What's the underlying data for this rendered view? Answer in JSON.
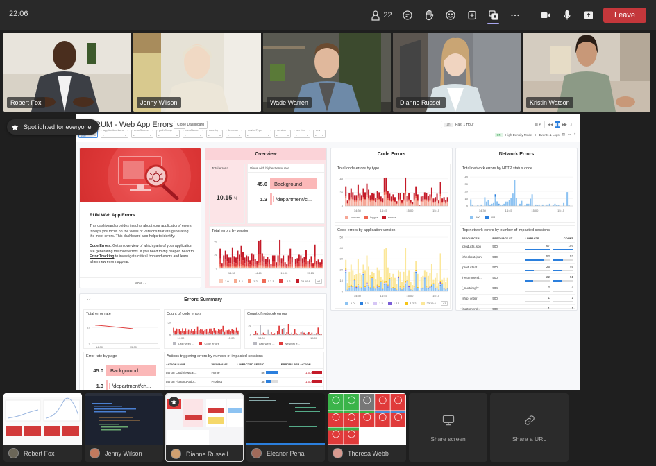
{
  "topbar": {
    "time": "22:06",
    "participants_count": "22",
    "icons": [
      "people-icon",
      "chat-icon",
      "raise-hand-icon",
      "reactions-icon",
      "apps-icon",
      "share-icon",
      "more-icon",
      "camera-icon",
      "mic-icon",
      "share-tray-icon"
    ],
    "leave_label": "Leave",
    "leave_color": "#c4373b"
  },
  "video_tiles": [
    {
      "name": "Robert Fox",
      "bg": "#c9c3b8"
    },
    {
      "name": "Jenny Wilson",
      "bg": "#d8d1bf"
    },
    {
      "name": "Wade Warren",
      "bg": "#6e6a5e"
    },
    {
      "name": "Dianne Russell",
      "bg": "#8c8f94"
    },
    {
      "name": "Kristin Watson",
      "bg": "#c8bfb2"
    }
  ],
  "spotlight": {
    "label": "Spotlighted for everyone"
  },
  "dashboard": {
    "title": "RUM - Web App Errors",
    "clone_label": "Clone Dashboard",
    "filters": [
      {
        "label": "type",
        "value": "user"
      },
      {
        "label": "applicationName",
        "value": "*"
      },
      {
        "label": "errorSource",
        "value": "*"
      },
      {
        "label": "pathGroup",
        "value": "*"
      },
      {
        "label": "viewName",
        "value": "*"
      },
      {
        "label": "country",
        "value": "*"
      },
      {
        "label": "browser",
        "value": "*"
      },
      {
        "label": "deviceType",
        "value": "*"
      },
      {
        "label": "version",
        "value": "*"
      },
      {
        "label": "service",
        "value": "*"
      },
      {
        "label": "env",
        "value": "*"
      }
    ],
    "time": {
      "short": "1h",
      "label": "Past 1 Hour"
    },
    "high_density": {
      "on": "ON",
      "label": "High Density Mode"
    },
    "events_logs": "Events & Logs",
    "about": {
      "title": "RUM Web App Errors",
      "p1": "This dashboard provides insights about your applications' errors. It helps you focus on the views or versions that are generating the most errors. This dashboard also helps to identify:",
      "p2_bold": "Code Errors:",
      "p2_a": " Get an overview of which parts of your application are generating the most errors. If you need to dig deeper, head to ",
      "p2_link": "Error Tracking",
      "p2_b": " to investigate critical frontend errors and learn when new errors appear.",
      "more": "More"
    },
    "overview": {
      "title": "Overview",
      "total_error_rate_label": "Total error r...",
      "total_error_rate_value": "10.15",
      "total_error_rate_unit": "%",
      "views_label": "Views with highest error rate",
      "views": [
        {
          "value": "45.0",
          "name": "Background",
          "fraction": 1.0
        },
        {
          "value": "1.3",
          "name": "/department/c...",
          "fraction": 0.03
        }
      ],
      "by_version_title": "Total errors by version"
    },
    "code_errors": {
      "title": "Code Errors",
      "by_type_title": "Total code errors by type",
      "by_app_version_title": "Code errors by application version"
    },
    "network_errors": {
      "title": "Network Errors",
      "by_status_title": "Total network errors by HTTP status code",
      "table_title": "Top network errors by number of impacted sessions",
      "columns": [
        "RESOURCE U...",
        "RESOURCE ST...",
        "↓ IMPACTE...",
        "COUNT"
      ],
      "rows": [
        {
          "url": "/products.json",
          "status": "500",
          "impacted": 67,
          "count": 107
        },
        {
          "url": "/checkout.json",
          "status": "500",
          "impacted": 52,
          "count": 52
        },
        {
          "url": "/products/?",
          "status": "500",
          "impacted": 25,
          "count": 46
        },
        {
          "url": "/recommend...",
          "status": "500",
          "impacted": 22,
          "count": 51
        },
        {
          "url": "/_nuxt/img/?",
          "status": "504",
          "impacted": 2,
          "count": 4
        },
        {
          "url": "/ship_order",
          "status": "500",
          "impacted": 1,
          "count": 1
        },
        {
          "url": "/customers/...",
          "status": "500",
          "impacted": 1,
          "count": 1
        }
      ]
    },
    "errors_summary": {
      "title": "Errors Summary",
      "total_error_rate_title": "Total error rate",
      "code_count_title": "Count of code errors",
      "network_count_title": "Count of network errors",
      "rate_by_page_title": "Error rate by page",
      "rate_by_page": [
        {
          "value": "45.0",
          "name": "Background",
          "fraction": 1.0
        },
        {
          "value": "1.3",
          "name": "/department/ch...",
          "fraction": 0.03
        }
      ],
      "actions_title": "Actions triggering errors by number of impacted sessions",
      "actions_columns": [
        "ACTION NAME",
        "VIEW NAME",
        "↓ IMPACTED SESSIO...",
        "ERRORS PER ACTION"
      ],
      "actions_rows": [
        {
          "action": "tap on CardView(cat...",
          "view": "Home",
          "impacted": 86,
          "errors": "1.00"
        },
        {
          "action": "tap on FloatingActio...",
          "view": "Product",
          "impacted": 38,
          "errors": "1.00"
        }
      ]
    }
  },
  "chart_data": [
    {
      "type": "bar",
      "title": "Total errors by version",
      "stacked": true,
      "x_ticks": [
        "14:30",
        "14:45",
        "15:00",
        "15:15"
      ],
      "y_ticks": [
        0,
        20,
        40
      ],
      "ylim": [
        0,
        45
      ],
      "legend": [
        "1.0",
        "1.1",
        "1.2",
        "1.2.1",
        "1.2.2",
        "23.19.6",
        "+1"
      ],
      "colors": [
        "#f9c9b8",
        "#f7a98f",
        "#f48a70",
        "#ef6a55",
        "#e04040",
        "#c41a28"
      ],
      "totals": [
        29,
        8,
        19,
        26,
        20,
        16,
        16,
        31,
        18,
        16,
        26,
        20,
        33,
        24,
        16,
        19,
        18,
        12,
        22,
        20,
        14,
        11,
        41,
        42,
        22,
        18,
        14,
        17,
        13,
        7,
        19,
        19,
        9,
        19,
        42,
        15,
        19,
        9,
        6,
        19,
        29,
        17,
        1,
        14,
        15,
        20,
        19,
        15,
        17,
        27,
        11,
        13,
        18,
        8,
        35,
        11,
        13,
        9,
        13
      ]
    },
    {
      "type": "bar",
      "title": "Total code errors by type",
      "stacked": true,
      "x_ticks": [
        "14:30",
        "14:45",
        "15:00",
        "15:15"
      ],
      "y_ticks": [
        0,
        20,
        40
      ],
      "ylim": [
        0,
        45
      ],
      "legend": [
        "custom",
        "logger",
        "source"
      ],
      "colors": [
        "#f6a796",
        "#ef6450",
        "#c41a28"
      ],
      "totals": [
        29,
        8,
        19,
        26,
        20,
        16,
        16,
        31,
        18,
        16,
        26,
        20,
        33,
        24,
        16,
        19,
        18,
        12,
        22,
        20,
        14,
        11,
        41,
        42,
        22,
        18,
        14,
        17,
        13,
        7,
        19,
        19,
        9,
        19,
        42,
        15,
        19,
        9,
        6,
        19,
        29,
        17,
        1,
        14,
        15,
        20,
        19,
        15,
        17,
        27,
        11,
        13,
        18,
        8,
        35,
        11,
        13,
        9,
        13
      ]
    },
    {
      "type": "bar",
      "title": "Code errors by application version",
      "stacked": true,
      "x_ticks": [
        "14:30",
        "14:45",
        "15:00",
        "15:15"
      ],
      "y_ticks": [
        0,
        10,
        20,
        30,
        40,
        50
      ],
      "ylim": [
        0,
        50
      ],
      "legend": [
        "1.0",
        "1.1",
        "1.2",
        "1.2.1",
        "1.2.2",
        "23.19.6",
        "+1"
      ],
      "colors": [
        "#8dc3f2",
        "#2b7fdd",
        "#d6c6f5",
        "#7b5fd6",
        "#f5c518",
        "#fbe79a"
      ],
      "totals": [
        29,
        8,
        19,
        26,
        20,
        16,
        16,
        31,
        18,
        16,
        26,
        20,
        33,
        24,
        16,
        19,
        18,
        12,
        22,
        20,
        14,
        11,
        41,
        42,
        22,
        18,
        14,
        17,
        13,
        7,
        19,
        19,
        9,
        19,
        42,
        15,
        19,
        9,
        6,
        19,
        29,
        17,
        1,
        14,
        15,
        20,
        19,
        15,
        17,
        27,
        11,
        13,
        18,
        8,
        35,
        11,
        13,
        9,
        13
      ]
    },
    {
      "type": "bar",
      "title": "Total network errors by HTTP status code",
      "stacked": true,
      "x_ticks": [
        "14:30",
        "14:45",
        "15:00",
        "15:15"
      ],
      "y_ticks": [
        0,
        10,
        20,
        30,
        40
      ],
      "ylim": [
        0,
        42
      ],
      "legend": [
        "500",
        "504"
      ],
      "colors": [
        "#8dc3f2",
        "#2b7fdd"
      ],
      "totals": [
        9,
        2,
        0,
        0,
        1,
        0,
        2,
        0,
        12,
        6,
        8,
        2,
        3,
        4,
        16,
        6,
        3,
        2,
        2,
        3,
        6,
        6,
        8,
        11,
        17,
        36,
        11,
        0,
        3,
        7,
        0,
        1,
        3,
        3,
        10,
        16,
        0,
        2,
        1,
        2,
        0,
        2,
        0,
        2,
        2,
        3,
        0,
        1,
        3,
        1,
        1,
        0,
        0,
        4,
        0,
        19,
        1,
        0,
        0
      ]
    },
    {
      "type": "line",
      "title": "Total error rate",
      "x_ticks": [
        "14:00",
        "15:00"
      ],
      "y_ticks": [
        0,
        10
      ],
      "ylim": [
        0,
        14
      ],
      "series": [
        {
          "name": "error rate",
          "values": [
            11.5,
            11.0,
            10.4,
            9.8,
            9.2
          ]
        }
      ],
      "colors": [
        "#e04040"
      ]
    },
    {
      "type": "bar",
      "title": "Count of code errors",
      "x_ticks": [
        "14:00",
        "15:00"
      ],
      "y_ticks": [
        0,
        50
      ],
      "ylim": [
        0,
        55
      ],
      "legend": [
        "Last week ...",
        "Code errors"
      ],
      "colors": [
        "#b8b8c0",
        "#e03a3a"
      ],
      "totals": [
        26,
        20,
        30,
        22,
        28,
        16,
        24,
        19,
        31,
        15,
        24,
        20,
        22,
        18,
        28,
        14,
        40,
        22,
        20,
        25,
        16,
        18,
        26,
        14,
        23,
        30,
        16,
        25,
        21,
        17,
        20,
        24,
        26,
        33,
        14,
        22,
        17,
        24,
        18,
        20,
        23,
        16,
        26,
        20
      ]
    },
    {
      "type": "bar",
      "title": "Count of network errors",
      "x_ticks": [
        "14:00",
        "15:00"
      ],
      "y_ticks": [
        0,
        20
      ],
      "ylim": [
        0,
        30
      ],
      "legend": [
        "Last week ...",
        "Network e..."
      ],
      "colors": [
        "#b8b8c0",
        "#e03a3a"
      ],
      "totals": [
        2,
        8,
        4,
        0,
        21,
        3,
        5,
        2,
        1,
        11,
        3,
        6,
        2,
        4,
        1,
        8,
        20,
        3,
        12,
        15,
        2,
        6,
        24,
        3,
        5,
        2,
        12,
        4,
        2,
        3,
        6,
        7,
        5,
        2,
        4,
        6,
        3,
        5,
        1,
        2,
        4,
        16,
        3,
        2
      ]
    }
  ],
  "share_tray": {
    "tiles": [
      {
        "name": "Robert Fox",
        "theme": "light",
        "selected": false
      },
      {
        "name": "Jenny Wilson",
        "theme": "code",
        "selected": false
      },
      {
        "name": "Dianne Russell",
        "theme": "dashboard",
        "selected": true
      },
      {
        "name": "Eleanor Pena",
        "theme": "terminal",
        "selected": false
      },
      {
        "name": "Theresa Webb",
        "theme": "grid",
        "selected": false
      }
    ],
    "share_screen_label": "Share screen",
    "share_url_label": "Share a URL"
  }
}
